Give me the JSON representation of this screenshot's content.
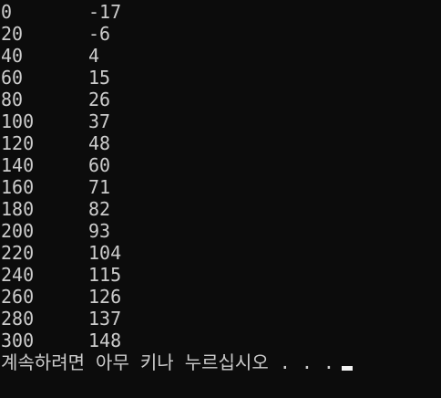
{
  "console": {
    "rows": [
      {
        "left": "0",
        "right": "-17"
      },
      {
        "left": "20",
        "right": "-6"
      },
      {
        "left": "40",
        "right": "4"
      },
      {
        "left": "60",
        "right": "15"
      },
      {
        "left": "80",
        "right": "26"
      },
      {
        "left": "100",
        "right": "37"
      },
      {
        "left": "120",
        "right": "48"
      },
      {
        "left": "140",
        "right": "60"
      },
      {
        "left": "160",
        "right": "71"
      },
      {
        "left": "180",
        "right": "82"
      },
      {
        "left": "200",
        "right": "93"
      },
      {
        "left": "220",
        "right": "104"
      },
      {
        "left": "240",
        "right": "115"
      },
      {
        "left": "260",
        "right": "126"
      },
      {
        "left": "280",
        "right": "137"
      },
      {
        "left": "300",
        "right": "148"
      }
    ],
    "prompt": "계속하려면 아무 키나 누르십시오 . . .",
    "colors": {
      "background": "#0c0c0c",
      "text": "#cccccc",
      "cursor": "#f2f2f2"
    }
  }
}
